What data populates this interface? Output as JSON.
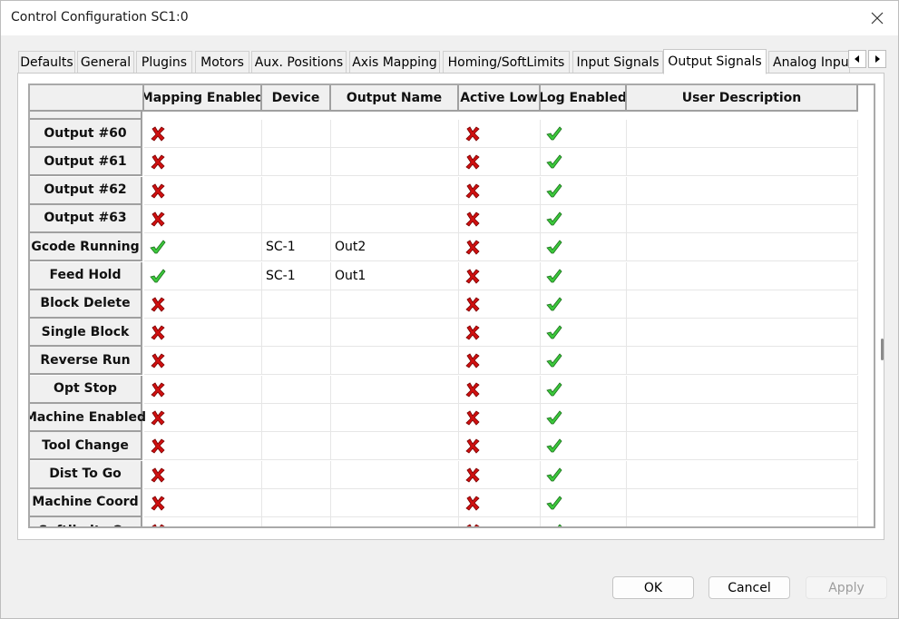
{
  "window": {
    "title": "Control Configuration SC1:0"
  },
  "tabs": [
    {
      "label": "Defaults",
      "active": false
    },
    {
      "label": "General",
      "active": false
    },
    {
      "label": "Plugins",
      "active": false
    },
    {
      "label": "Motors",
      "active": false
    },
    {
      "label": "Aux. Positions",
      "active": false
    },
    {
      "label": "Axis Mapping",
      "active": false
    },
    {
      "label": "Homing/SoftLimits",
      "active": false
    },
    {
      "label": "Input Signals",
      "active": false
    },
    {
      "label": "Output Signals",
      "active": true
    },
    {
      "label": "Analog Inpu",
      "active": false
    }
  ],
  "grid": {
    "columns": [
      "Mapping Enabled",
      "Device",
      "Output Name",
      "Active Low",
      "Log Enabled",
      "User Description"
    ],
    "rows": [
      {
        "name": "Output #60",
        "mapping": "x",
        "device": "",
        "output": "",
        "active_low": "x",
        "log": "check",
        "desc": ""
      },
      {
        "name": "Output #61",
        "mapping": "x",
        "device": "",
        "output": "",
        "active_low": "x",
        "log": "check",
        "desc": ""
      },
      {
        "name": "Output #62",
        "mapping": "x",
        "device": "",
        "output": "",
        "active_low": "x",
        "log": "check",
        "desc": ""
      },
      {
        "name": "Output #63",
        "mapping": "x",
        "device": "",
        "output": "",
        "active_low": "x",
        "log": "check",
        "desc": ""
      },
      {
        "name": "Gcode Running",
        "mapping": "check",
        "device": "SC-1",
        "output": "Out2",
        "active_low": "x",
        "log": "check",
        "desc": ""
      },
      {
        "name": "Feed Hold",
        "mapping": "check",
        "device": "SC-1",
        "output": "Out1",
        "active_low": "x",
        "log": "check",
        "desc": ""
      },
      {
        "name": "Block Delete",
        "mapping": "x",
        "device": "",
        "output": "",
        "active_low": "x",
        "log": "check",
        "desc": ""
      },
      {
        "name": "Single Block",
        "mapping": "x",
        "device": "",
        "output": "",
        "active_low": "x",
        "log": "check",
        "desc": ""
      },
      {
        "name": "Reverse Run",
        "mapping": "x",
        "device": "",
        "output": "",
        "active_low": "x",
        "log": "check",
        "desc": ""
      },
      {
        "name": "Opt Stop",
        "mapping": "x",
        "device": "",
        "output": "",
        "active_low": "x",
        "log": "check",
        "desc": ""
      },
      {
        "name": "Machine Enabled",
        "mapping": "x",
        "device": "",
        "output": "",
        "active_low": "x",
        "log": "check",
        "desc": ""
      },
      {
        "name": "Tool Change",
        "mapping": "x",
        "device": "",
        "output": "",
        "active_low": "x",
        "log": "check",
        "desc": ""
      },
      {
        "name": "Dist To Go",
        "mapping": "x",
        "device": "",
        "output": "",
        "active_low": "x",
        "log": "check",
        "desc": ""
      },
      {
        "name": "Machine Coord",
        "mapping": "x",
        "device": "",
        "output": "",
        "active_low": "x",
        "log": "check",
        "desc": ""
      },
      {
        "name": "Softlimits On",
        "mapping": "x",
        "device": "",
        "output": "",
        "active_low": "x",
        "log": "check",
        "desc": ""
      }
    ]
  },
  "buttons": {
    "ok": "OK",
    "cancel": "Cancel",
    "apply": "Apply"
  },
  "icons": {
    "close": "close-icon",
    "scroll_left": "arrow-left-icon",
    "scroll_right": "arrow-right-icon",
    "disabled_mark": "red-x-icon",
    "enabled_mark": "green-check-icon"
  },
  "colors": {
    "x_mark": "#d01010",
    "check_mark": "#2ab52a",
    "header_bg": "#f0f0f0",
    "selected_tab_bg": "#ffffff"
  }
}
